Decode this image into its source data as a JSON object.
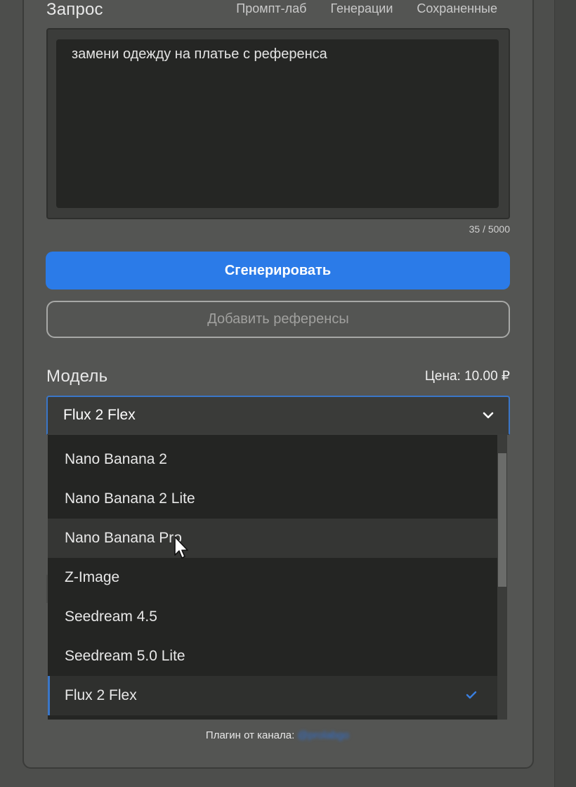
{
  "prompt": {
    "title": "Запрос",
    "text": "замени одежду на платье с референса",
    "counter": "35 / 5000"
  },
  "tabs": [
    "Промпт-лаб",
    "Генерации",
    "Сохраненные"
  ],
  "buttons": {
    "generate": "Сгенерировать",
    "add_refs": "Добавить референсы"
  },
  "model": {
    "title": "Модель",
    "price": "Цена: 10.00 ₽",
    "selected": "Flux 2 Flex",
    "hovered": "Nano Banana Pro",
    "options": [
      "Nano Banana 2",
      "Nano Banana 2 Lite",
      "Nano Banana Pro",
      "Z-Image",
      "Seedream 4.5",
      "Seedream 5.0 Lite",
      "Flux 2 Flex"
    ]
  },
  "footer": {
    "text": "Плагин от канала:",
    "link": "@prolabgo"
  },
  "colors": {
    "accent": "#2b7be8",
    "panel": "#545553",
    "dropdown": "#242523"
  }
}
